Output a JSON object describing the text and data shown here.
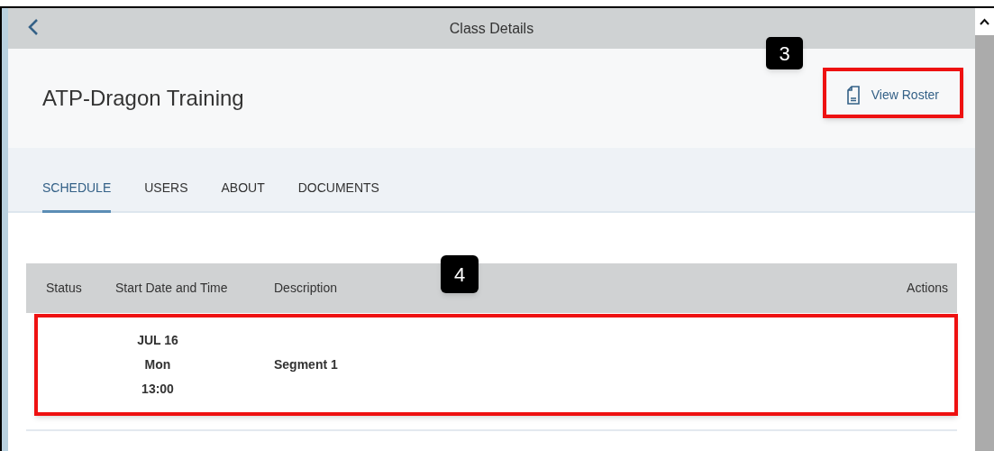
{
  "header": {
    "title": "Class Details"
  },
  "class_title": "ATP-Dragon Training",
  "view_roster": {
    "label": "View Roster"
  },
  "tabs": [
    {
      "label": "SCHEDULE",
      "selected": true
    },
    {
      "label": "USERS",
      "selected": false
    },
    {
      "label": "ABOUT",
      "selected": false
    },
    {
      "label": "DOCUMENTS",
      "selected": false
    }
  ],
  "table": {
    "columns": [
      "Status",
      "Start Date and Time",
      "Description",
      "Actions"
    ],
    "rows": [
      {
        "date": "JUL 16",
        "weekday": "Mon",
        "time": "13:00",
        "description": "Segment 1"
      }
    ]
  },
  "callouts": [
    {
      "label": "3"
    },
    {
      "label": "4"
    }
  ]
}
